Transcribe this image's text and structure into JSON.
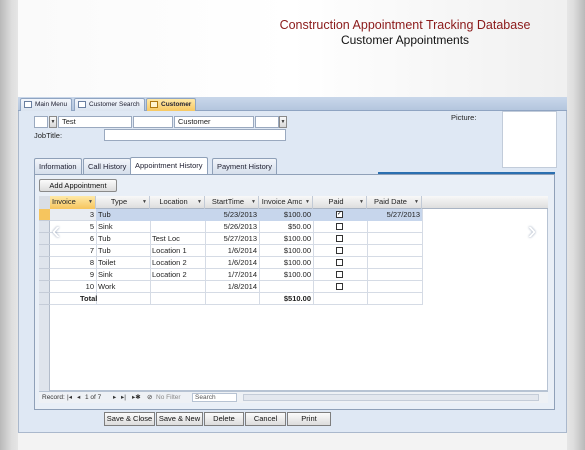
{
  "report": {
    "title": "Construction Appointment Tracking Database",
    "subtitle": "Customer Appointments"
  },
  "doc_tabs": [
    {
      "label": "Main Menu",
      "icon": "form-icon",
      "active": false
    },
    {
      "label": "Customer Search",
      "icon": "form-icon",
      "active": false
    },
    {
      "label": "Customer",
      "icon": "form-icon",
      "active": true
    }
  ],
  "header_fields": {
    "first_name": "Test",
    "middle": "",
    "company": "Customer",
    "job_title_label": "JobTitle:",
    "job_title": "",
    "picture_label": "Picture:"
  },
  "sub_tabs": [
    {
      "label": "Information",
      "active": false
    },
    {
      "label": "Call History",
      "active": false
    },
    {
      "label": "Appointment History",
      "active": true
    },
    {
      "label": "Payment History",
      "active": false
    }
  ],
  "add_button": "Add Appointment",
  "grid": {
    "columns": [
      "Invoice",
      "Type",
      "Location",
      "StartTime",
      "Invoice Amc",
      "Paid",
      "Paid Date"
    ],
    "rows": [
      {
        "invoice": "3",
        "type": "Tub",
        "location": "",
        "start": "5/23/2013",
        "amount": "$100.00",
        "paid": true,
        "paid_date": "5/27/2013"
      },
      {
        "invoice": "5",
        "type": "Sink",
        "location": "",
        "start": "5/26/2013",
        "amount": "$50.00",
        "paid": false,
        "paid_date": ""
      },
      {
        "invoice": "6",
        "type": "Tub",
        "location": "Test Loc",
        "start": "5/27/2013",
        "amount": "$100.00",
        "paid": false,
        "paid_date": ""
      },
      {
        "invoice": "7",
        "type": "Tub",
        "location": "Location 1",
        "start": "1/6/2014",
        "amount": "$100.00",
        "paid": false,
        "paid_date": ""
      },
      {
        "invoice": "8",
        "type": "Toilet",
        "location": "Location 2",
        "start": "1/6/2014",
        "amount": "$100.00",
        "paid": false,
        "paid_date": ""
      },
      {
        "invoice": "9",
        "type": "Sink",
        "location": "Location 2",
        "start": "1/7/2014",
        "amount": "$100.00",
        "paid": false,
        "paid_date": ""
      },
      {
        "invoice": "10",
        "type": "Work",
        "location": "",
        "start": "1/8/2014",
        "amount": "",
        "paid": false,
        "paid_date": ""
      }
    ],
    "total_label": "Total",
    "total_amount": "$510.00"
  },
  "nav": {
    "record_label": "Record:",
    "position": "1 of 7",
    "filter_label": "No Filter",
    "search_label": "Search"
  },
  "buttons": {
    "save_close": "Save & Close",
    "save_new": "Save & New",
    "delete": "Delete",
    "cancel": "Cancel",
    "print": "Print"
  },
  "colors": {
    "title_red": "#8b1a1a",
    "active_tab": "#f6c55e",
    "form_bg": "#dfe8f4"
  }
}
